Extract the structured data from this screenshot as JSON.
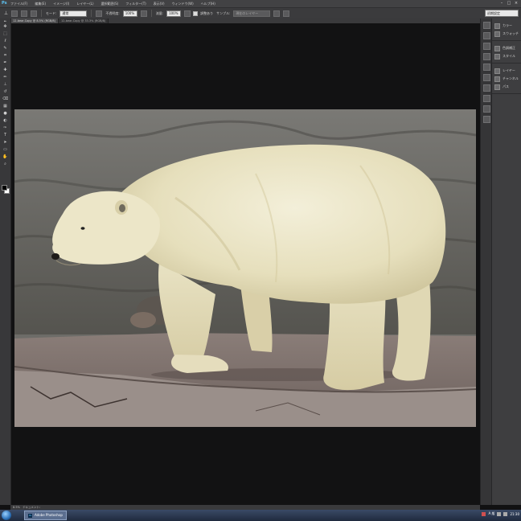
{
  "app": {
    "logo": "Ps"
  },
  "menubar": {
    "items": [
      "ファイル(F)",
      "編集(E)",
      "イメージ(I)",
      "レイヤー(L)",
      "選択範囲(S)",
      "フィルター(T)",
      "表示(V)",
      "ウィンドウ(W)",
      "ヘルプ(H)"
    ]
  },
  "window_controls": {
    "minimize": "–",
    "maximize": "□",
    "close": "×"
  },
  "options": {
    "mode_label": "モード:",
    "mode_value": "通常",
    "opacity_label": "不透明度:",
    "opacity_value": "100%",
    "flow_label": "流量:",
    "flow_value": "100%",
    "align_label": "調整あり",
    "sample_label": "サンプル:",
    "sample_value": "現在のレイヤー",
    "workspace": "初期設定"
  },
  "tabs": [
    {
      "label": "12-bear-Copy @ 8.5% (RGB/8)",
      "active": true
    },
    {
      "label": "12-bear-Copy @ 33.3% (RGB/8)",
      "active": false
    }
  ],
  "tools": [
    "move-tool",
    "marquee-tool",
    "lasso-tool",
    "quick-select-tool",
    "crop-tool",
    "eyedropper-tool",
    "healing-tool",
    "brush-tool",
    "clone-stamp-tool",
    "history-brush-tool",
    "eraser-tool",
    "gradient-tool",
    "blur-tool",
    "dodge-tool",
    "pen-tool",
    "type-tool",
    "path-select-tool",
    "shape-tool",
    "hand-tool",
    "zoom-tool"
  ],
  "tool_glyphs": [
    "✥",
    "⬚",
    "ℓ",
    "✎",
    "⌗",
    "✒",
    "✚",
    "✏",
    "⊥",
    "↺",
    "⌫",
    "▦",
    "●",
    "◐",
    "✑",
    "T",
    "➤",
    "▭",
    "✋",
    "⌕"
  ],
  "panels": [
    {
      "label": "カラー",
      "icon": "color-icon"
    },
    {
      "label": "スウォッチ",
      "icon": "swatches-icon"
    },
    {
      "label": "色調補正",
      "icon": "adjustments-icon"
    },
    {
      "label": "スタイル",
      "icon": "styles-icon"
    },
    {
      "label": "レイヤー",
      "icon": "layers-icon"
    },
    {
      "label": "チャンネル",
      "icon": "channels-icon"
    },
    {
      "label": "パス",
      "icon": "paths-icon"
    }
  ],
  "status": {
    "zoom": "8.5%",
    "info": "ドキュメント:"
  },
  "taskbar": {
    "app_button": "Adobe Photoshop",
    "time": "21:30",
    "ime": "A 般"
  }
}
